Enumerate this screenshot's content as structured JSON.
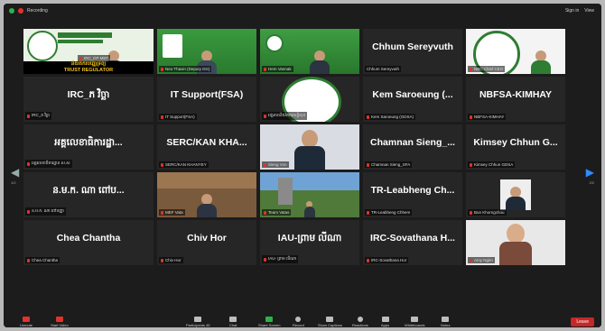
{
  "topbar": {
    "recording": "Recording",
    "sign_in": "Sign in",
    "view": "View"
  },
  "tiles": [
    {
      "id": "t0",
      "big": "",
      "label": "IRC_DP MEF",
      "mic": true
    },
    {
      "id": "t1",
      "big": "",
      "label": "Neo Thavin (Deputy DG)",
      "mic": true,
      "active": true
    },
    {
      "id": "t2",
      "big": "",
      "label": "Hem Vannak",
      "mic": true
    },
    {
      "id": "t3",
      "big": "Chhum Sereyvuth",
      "label": "Chhum Sereyvuth",
      "mic": false
    },
    {
      "id": "t4",
      "big": "",
      "label": "NBC Chief CEO",
      "mic": true
    },
    {
      "id": "t5",
      "big": "IRC_ភ វិច្ឆា",
      "label": "IRC_ភ វិច្ឆា",
      "mic": true
    },
    {
      "id": "t6",
      "big": "IT Support(FSA)",
      "label": "IT Support(FSA)",
      "mic": true
    },
    {
      "id": "t7",
      "big": "",
      "label": "អង្គភាពនិយ័តករសន្តិសុខ",
      "mic": true
    },
    {
      "id": "t8",
      "big": "Kem Saroeung (...",
      "label": "Kem Saroeung (GDSA)",
      "mic": true
    },
    {
      "id": "t9",
      "big": "NBFSA-KIMHAY",
      "label": "NBFSA-KIMHAY",
      "mic": true
    },
    {
      "id": "t10",
      "big": "អគ្គលេខាធិការដ្ឋា...",
      "label": "អគ្គលេខាធិការដ្ឋាន ស.ស",
      "mic": true
    },
    {
      "id": "t11",
      "big": "SERC/KAN KHA...",
      "label": "SERC/KAN KHANYEY",
      "mic": true
    },
    {
      "id": "t12",
      "big": "",
      "label": "Sieng Von",
      "mic": true
    },
    {
      "id": "t13",
      "big": "Chamnan Sieng_...",
      "label": "Chamnan Sieng_SFA",
      "mic": true
    },
    {
      "id": "t14",
      "big": "Kimsey Chhun G...",
      "label": "Kimsey Chhun GDSA",
      "mic": true
    },
    {
      "id": "t15",
      "big": "ន.ម.ក. ណា ពៅប...",
      "label": "ន.ម.ក. ណា ពៅបញ្ញា",
      "mic": true
    },
    {
      "id": "t16",
      "big": "",
      "label": "MEF Vata",
      "mic": true
    },
    {
      "id": "t17",
      "big": "",
      "label": "Team Vatas",
      "mic": true
    },
    {
      "id": "t18",
      "big": "TR-Leabheng Ch...",
      "label": "TR-Leabheng Chhem",
      "mic": true
    },
    {
      "id": "t19",
      "big": "",
      "label": "Bun Khorngchou",
      "mic": true
    },
    {
      "id": "t20",
      "big": "Chea Chantha",
      "label": "Chea Chantha",
      "mic": true
    },
    {
      "id": "t21",
      "big": "Chiv Hor",
      "label": "Chiv Hor",
      "mic": true
    },
    {
      "id": "t22",
      "big": "IAU-ព្រាម លីណា",
      "label": "IAU- ព្រាម លីណា",
      "mic": true
    },
    {
      "id": "t23",
      "big": "IRC-Sovathana H...",
      "label": "IRC-Sovathana Hor",
      "mic": true
    },
    {
      "id": "t24",
      "big": "",
      "label": "Amy Ngim",
      "mic": true
    }
  ],
  "trust_regulator": "TRUST REGULATOR",
  "trust_regulator_kh": "និយ័តករបញ្ញើទ្រព្យ",
  "page_left": "1/2",
  "page_right": "2/2",
  "bottombar": {
    "unmute": "Unmute",
    "start_video": "Start Video",
    "participants": "Participants",
    "participants_count": "45",
    "chat": "Chat",
    "share_screen": "Share Screen",
    "record": "Record",
    "show_captions": "Show Captions",
    "reactions": "Reactions",
    "apps": "Apps",
    "whiteboards": "Whiteboards",
    "notes": "Notes",
    "leave": "Leave"
  }
}
